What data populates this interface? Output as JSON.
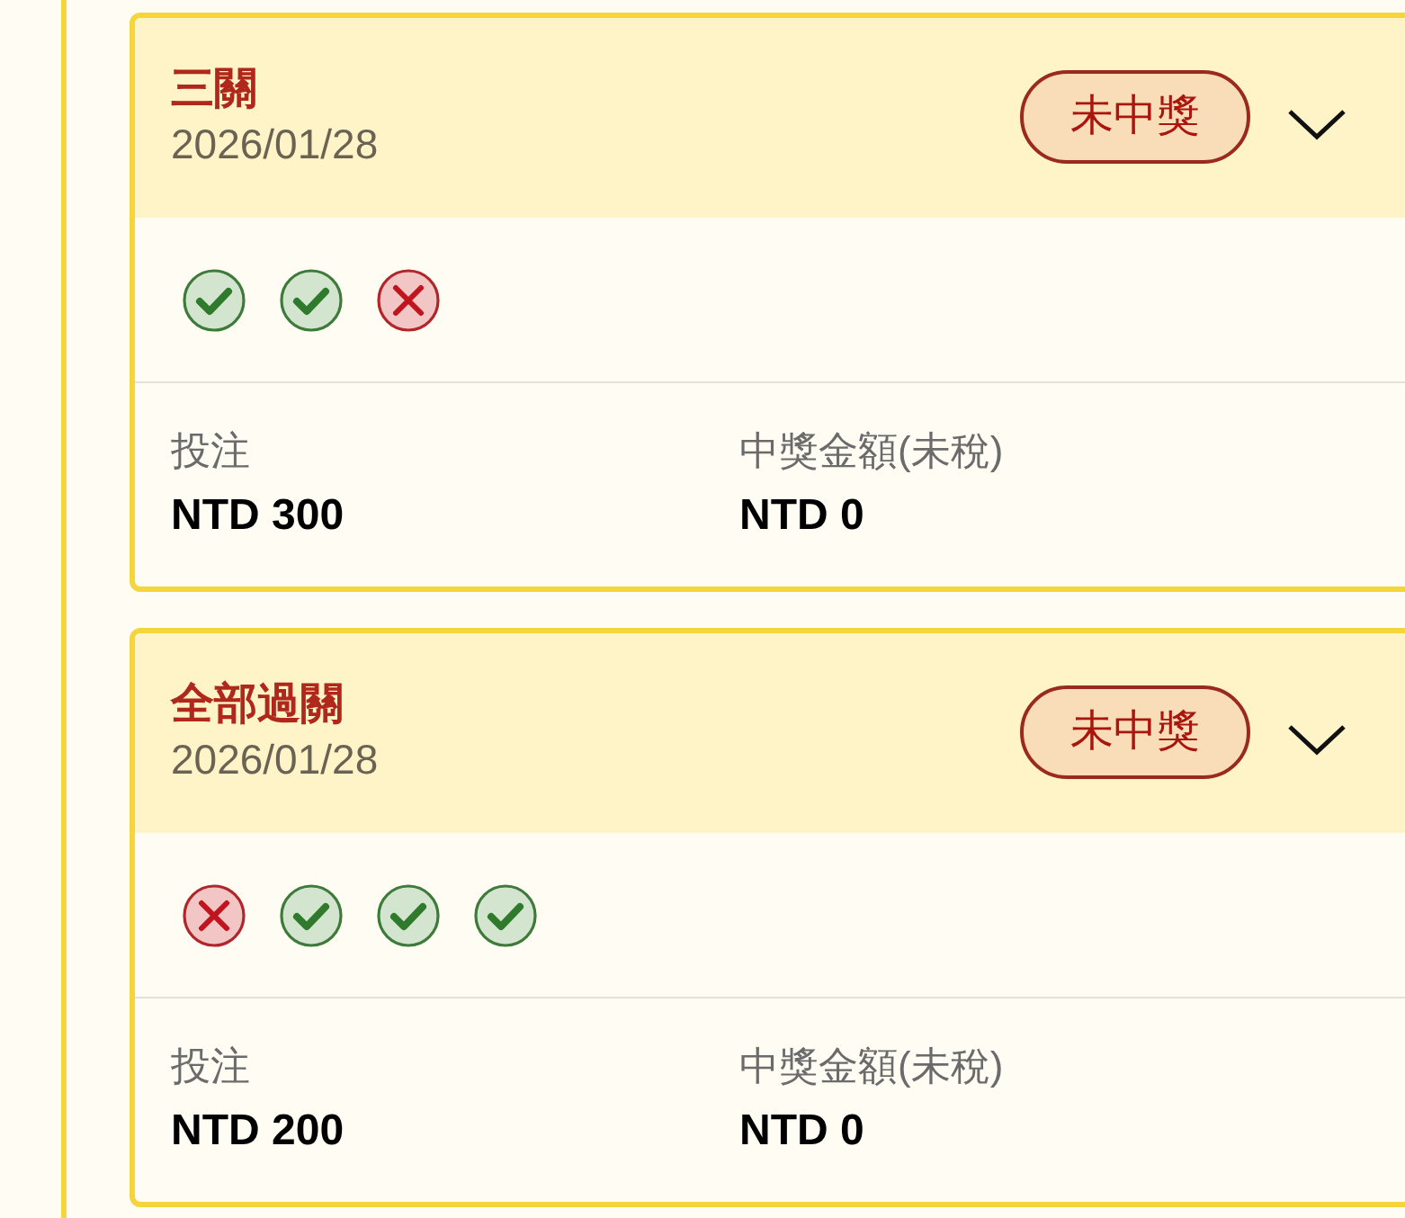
{
  "bets": [
    {
      "title": "三關",
      "date": "2026/01/28",
      "status": "未中獎",
      "legs": [
        {
          "won": true
        },
        {
          "won": true
        },
        {
          "won": false
        }
      ],
      "stake_label": "投注",
      "stake": "NTD 300",
      "payout_label": "中獎金額(未稅)",
      "payout": "NTD 0"
    },
    {
      "title": "全部過關",
      "date": "2026/01/28",
      "status": "未中獎",
      "legs": [
        {
          "won": false
        },
        {
          "won": true
        },
        {
          "won": true
        },
        {
          "won": true
        }
      ],
      "stake_label": "投注",
      "stake": "NTD 200",
      "payout_label": "中獎金額(未稅)",
      "payout": "NTD 0"
    }
  ]
}
